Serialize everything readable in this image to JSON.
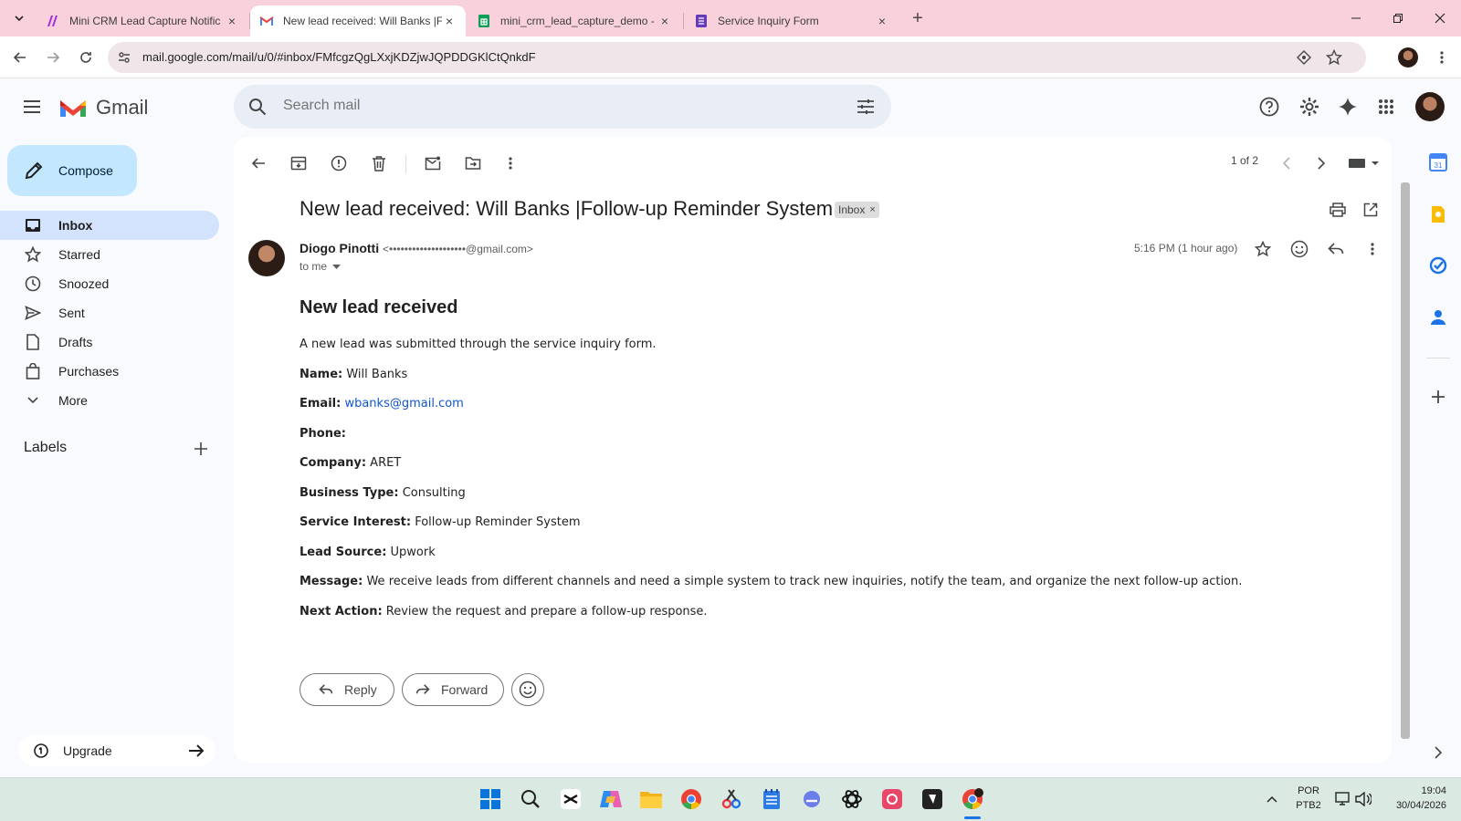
{
  "browser": {
    "tabs": [
      {
        "title": "Mini CRM Lead Capture Notific"
      },
      {
        "title": "New lead received: Will Banks |F"
      },
      {
        "title": "mini_crm_lead_capture_demo -"
      },
      {
        "title": "Service Inquiry Form"
      }
    ],
    "url": "mail.google.com/mail/u/0/#inbox/FMfcgzQgLXxjKDZjwJQPDDGKlCtQnkdF"
  },
  "gmail": {
    "logo_text": "Gmail",
    "search_placeholder": "Search mail",
    "compose_label": "Compose",
    "nav": [
      {
        "label": "Inbox",
        "icon": "inbox-icon"
      },
      {
        "label": "Starred",
        "icon": "star-icon"
      },
      {
        "label": "Snoozed",
        "icon": "clock-icon"
      },
      {
        "label": "Sent",
        "icon": "send-icon"
      },
      {
        "label": "Drafts",
        "icon": "draft-icon"
      },
      {
        "label": "Purchases",
        "icon": "bag-icon"
      },
      {
        "label": "More",
        "icon": "chevron-down-icon"
      }
    ],
    "labels_heading": "Labels",
    "upgrade_label": "Upgrade",
    "pagination": "1 of 2"
  },
  "email": {
    "subject": "New lead received: Will Banks |Follow-up Reminder System",
    "tag": "Inbox",
    "sender_name": "Diogo Pinotti",
    "sender_email": "<••••••••••••••••••••@gmail.com>",
    "recipient": "to me",
    "time": "5:16 PM (1 hour ago)",
    "heading": "New lead received",
    "intro": "A new lead was submitted through the service inquiry form.",
    "fields": [
      {
        "label": "Name:",
        "value": "Will Banks"
      },
      {
        "label": "Email:",
        "value": "wbanks@gmail.com",
        "link": true
      },
      {
        "label": "Phone:",
        "value": ""
      },
      {
        "label": "Company:",
        "value": "ARET"
      },
      {
        "label": "Business Type:",
        "value": "Consulting"
      },
      {
        "label": "Service Interest:",
        "value": "Follow-up Reminder System"
      },
      {
        "label": "Lead Source:",
        "value": "Upwork"
      },
      {
        "label": "Message:",
        "value": "We receive leads from different channels and need a simple system to track new inquiries, notify the team, and organize the next follow-up action."
      },
      {
        "label": "Next Action:",
        "value": "Review the request and prepare a follow-up response."
      }
    ],
    "reply_label": "Reply",
    "forward_label": "Forward"
  },
  "taskbar": {
    "lang_top": "POR",
    "lang_bottom": "PTB2",
    "time": "19:04",
    "date": "30/04/2026"
  },
  "colors": {
    "tabbar": "#f9d1dc",
    "compose": "#c2e7ff",
    "selected_nav": "#d3e3fd",
    "link": "#1155cc",
    "gmail_red": "#ea4335"
  }
}
